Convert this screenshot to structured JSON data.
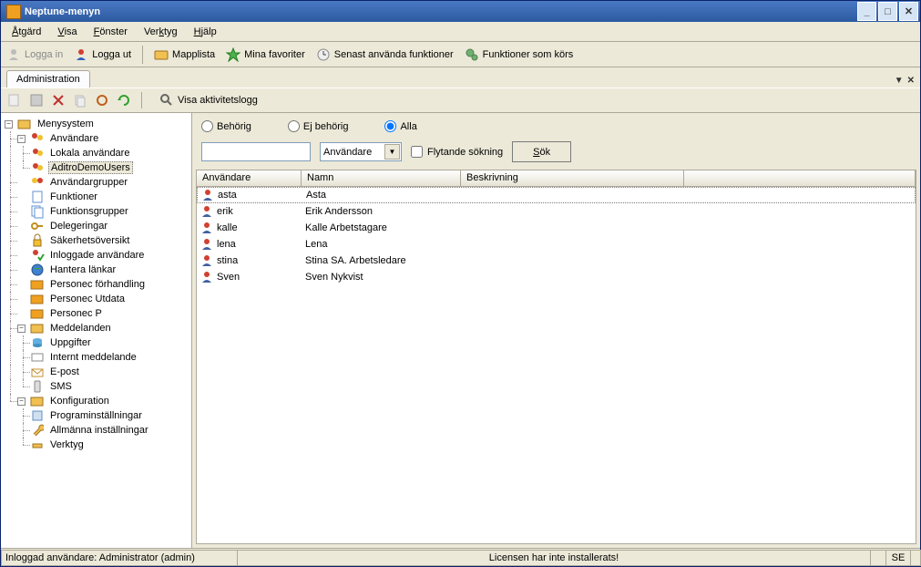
{
  "titlebar": {
    "title": "Neptune-menyn"
  },
  "menu": {
    "items": [
      "Åtgärd",
      "Visa",
      "Fönster",
      "Verktyg",
      "Hjälp"
    ]
  },
  "toolbar1": {
    "login": "Logga in",
    "logout": "Logga ut",
    "folder_list": "Mapplista",
    "favorites": "Mina favoriter",
    "recent": "Senast använda funktioner",
    "running": "Funktioner som körs"
  },
  "tabs": {
    "admin": "Administration"
  },
  "toolbar2": {
    "show_log": "Visa aktivitetslogg"
  },
  "tree": {
    "root": "Menysystem",
    "users": "Användare",
    "local_users": "Lokala användare",
    "aditro": "AditroDemoUsers",
    "user_groups": "Användargrupper",
    "functions": "Funktioner",
    "function_groups": "Funktionsgrupper",
    "delegations": "Delegeringar",
    "security_overview": "Säkerhetsöversikt",
    "logged_in": "Inloggade användare",
    "manage_links": "Hantera länkar",
    "personec_forh": "Personec förhandling",
    "personec_utdata": "Personec Utdata",
    "personec_p": "Personec P",
    "messages": "Meddelanden",
    "tasks": "Uppgifter",
    "internal_msg": "Internt meddelande",
    "email": "E-post",
    "sms": "SMS",
    "config": "Konfiguration",
    "program_settings": "Programinställningar",
    "general_settings": "Allmänna inställningar",
    "tools": "Verktyg"
  },
  "filter": {
    "authorized": "Behörig",
    "unauthorized": "Ej behörig",
    "all": "Alla",
    "select": "Användare",
    "floating": "Flytande sökning",
    "search": "Sök"
  },
  "table": {
    "cols": [
      "Användare",
      "Namn",
      "Beskrivning"
    ],
    "rows": [
      {
        "user": "asta",
        "name": "Asta"
      },
      {
        "user": "erik",
        "name": "Erik Andersson"
      },
      {
        "user": "kalle",
        "name": "Kalle Arbetstagare"
      },
      {
        "user": "lena",
        "name": "Lena"
      },
      {
        "user": "stina",
        "name": "Stina SA. Arbetsledare"
      },
      {
        "user": "Sven",
        "name": "Sven Nykvist"
      }
    ]
  },
  "status": {
    "user": "Inloggad användare: Administrator (admin)",
    "license": "Licensen har inte installerats!",
    "lang": "SE"
  }
}
